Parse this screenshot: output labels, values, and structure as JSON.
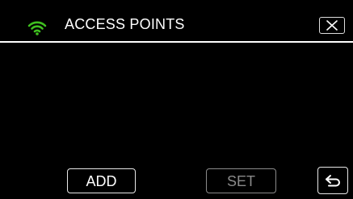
{
  "header": {
    "title": "ACCESS POINTS",
    "wifi_icon": "wifi-icon",
    "close_icon": "close-icon"
  },
  "footer": {
    "add_label": "ADD",
    "set_label": "SET",
    "back_icon": "return-arrow-icon"
  },
  "colors": {
    "background": "#000000",
    "wifi_green": "#3fbf1f",
    "text": "#ffffff",
    "disabled_text": "#8a8a8a"
  }
}
